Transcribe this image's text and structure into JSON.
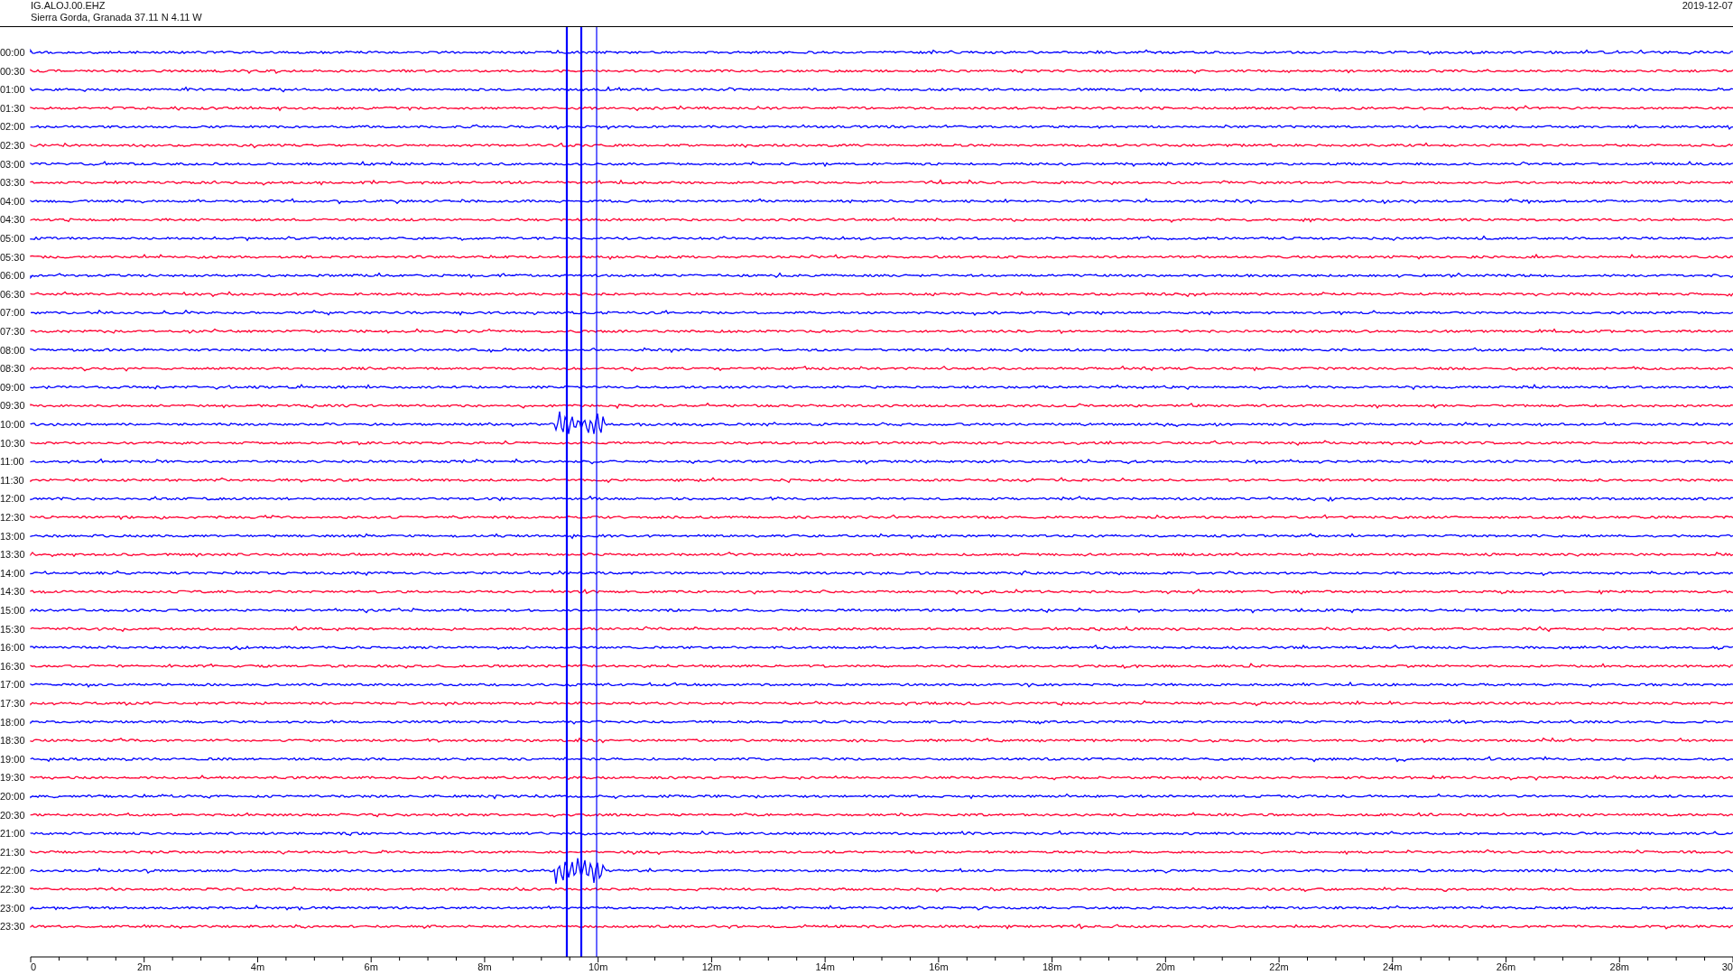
{
  "header": {
    "station": "IG.ALOJ.00.EHZ",
    "location": "Sierra Gorda, Granada  37.11 N 4.11 W",
    "date": "2019-12-07"
  },
  "rows": [
    {
      "time": "00:00",
      "color": "#0000ff"
    },
    {
      "time": "00:30",
      "color": "#ff0033"
    },
    {
      "time": "01:00",
      "color": "#0000ff"
    },
    {
      "time": "01:30",
      "color": "#ff0033"
    },
    {
      "time": "02:00",
      "color": "#0000ff"
    },
    {
      "time": "02:30",
      "color": "#ff0033"
    },
    {
      "time": "03:00",
      "color": "#0000ff"
    },
    {
      "time": "03:30",
      "color": "#ff0033"
    },
    {
      "time": "04:00",
      "color": "#0000ff"
    },
    {
      "time": "04:30",
      "color": "#ff0033"
    },
    {
      "time": "05:00",
      "color": "#0000ff"
    },
    {
      "time": "05:30",
      "color": "#ff0033"
    },
    {
      "time": "06:00",
      "color": "#0000ff"
    },
    {
      "time": "06:30",
      "color": "#ff0033"
    },
    {
      "time": "07:00",
      "color": "#0000ff"
    },
    {
      "time": "07:30",
      "color": "#ff0033"
    },
    {
      "time": "08:00",
      "color": "#0000ff"
    },
    {
      "time": "08:30",
      "color": "#ff0033"
    },
    {
      "time": "09:00",
      "color": "#0000ff"
    },
    {
      "time": "09:30",
      "color": "#ff0033"
    },
    {
      "time": "10:00",
      "color": "#0000ff"
    },
    {
      "time": "10:30",
      "color": "#ff0033"
    },
    {
      "time": "11:00",
      "color": "#0000ff"
    },
    {
      "time": "11:30",
      "color": "#ff0033"
    },
    {
      "time": "12:00",
      "color": "#0000ff"
    },
    {
      "time": "12:30",
      "color": "#ff0033"
    },
    {
      "time": "13:00",
      "color": "#0000ff"
    },
    {
      "time": "13:30",
      "color": "#ff0033"
    },
    {
      "time": "14:00",
      "color": "#0000ff"
    },
    {
      "time": "14:30",
      "color": "#ff0033"
    },
    {
      "time": "15:00",
      "color": "#0000ff"
    },
    {
      "time": "15:30",
      "color": "#ff0033"
    },
    {
      "time": "16:00",
      "color": "#0000ff"
    },
    {
      "time": "16:30",
      "color": "#ff0033"
    },
    {
      "time": "17:00",
      "color": "#0000ff"
    },
    {
      "time": "17:30",
      "color": "#ff0033"
    },
    {
      "time": "18:00",
      "color": "#0000ff"
    },
    {
      "time": "18:30",
      "color": "#ff0033"
    },
    {
      "time": "19:00",
      "color": "#0000ff"
    },
    {
      "time": "19:30",
      "color": "#ff0033"
    },
    {
      "time": "20:00",
      "color": "#0000ff"
    },
    {
      "time": "20:30",
      "color": "#ff0033"
    },
    {
      "time": "21:00",
      "color": "#0000ff"
    },
    {
      "time": "21:30",
      "color": "#ff0033"
    },
    {
      "time": "22:00",
      "color": "#0000ff"
    },
    {
      "time": "22:30",
      "color": "#ff0033"
    },
    {
      "time": "23:00",
      "color": "#0000ff"
    },
    {
      "time": "23:30",
      "color": "#ff0033"
    }
  ],
  "x_axis": {
    "labels": [
      "0",
      "2m",
      "4m",
      "6m",
      "8m",
      "10m",
      "12m",
      "14m",
      "16m",
      "18m",
      "20m",
      "22m",
      "24m",
      "26m",
      "28m",
      "30"
    ]
  }
}
